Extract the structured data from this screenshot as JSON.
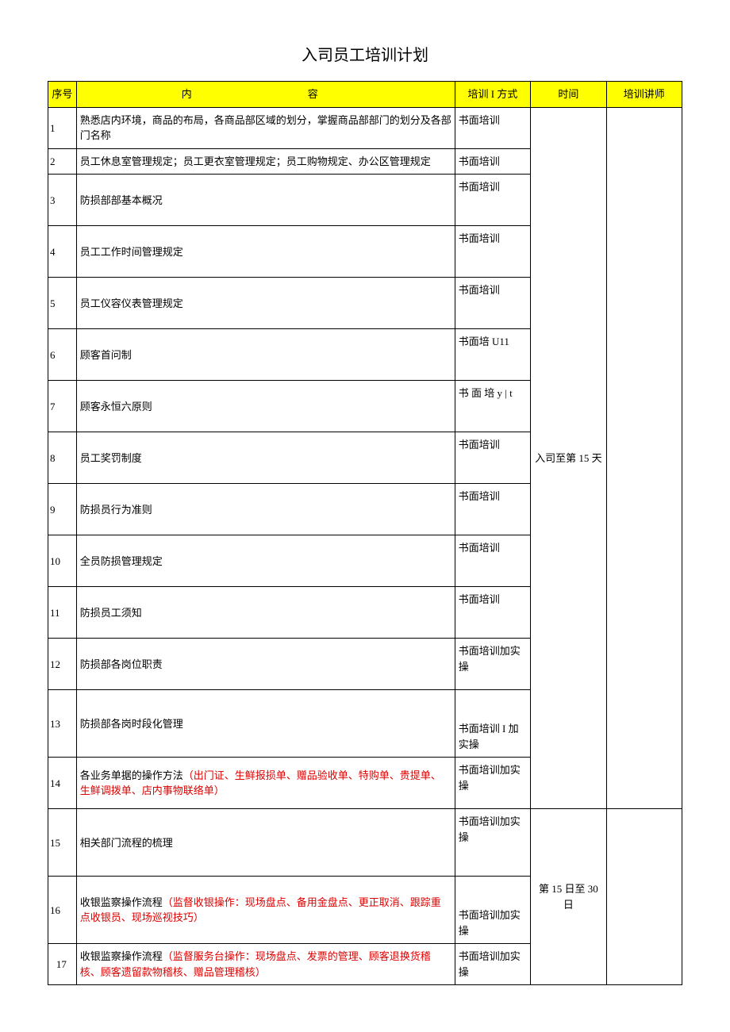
{
  "title": "入司员工培训计划",
  "headers": {
    "num": "序号",
    "content": "内　　容",
    "method": "培训 I 方式",
    "time": "时间",
    "instructor": "培训讲师"
  },
  "time_block_1": "入司至第 15 天",
  "time_block_2": "第 15 日至 30 日",
  "rows": [
    {
      "n": "1",
      "content": "熟悉店内环境，商品的布局，各商品部区域的划分，掌握商品部部门的划分及各部门名称",
      "method": "书面培训"
    },
    {
      "n": "2",
      "content": "员工休息室管理规定；员工更衣室管理规定；员工购物规定、办公区管理规定",
      "method": "书面培训"
    },
    {
      "n": "3",
      "content": "防损部部基本概况",
      "method": "书面培训"
    },
    {
      "n": "4",
      "content": "员工工作时间管理规定",
      "method": "书面培训"
    },
    {
      "n": "5",
      "content": "员工仪容仪表管理规定",
      "method": "书面培训"
    },
    {
      "n": "6",
      "content": "顾客首问制",
      "method": "书面培 U11"
    },
    {
      "n": "7",
      "content": "顾客永恒六原则",
      "method": "书 面 培 y | t"
    },
    {
      "n": "8",
      "content": "员工奖罚制度",
      "method": "书面培训"
    },
    {
      "n": "9",
      "content": "防损员行为准则",
      "method": "书面培训"
    },
    {
      "n": "10",
      "content": "全员防损管理规定",
      "method": "书面培训"
    },
    {
      "n": "11",
      "content": "防损员工须知",
      "method": "书面培训"
    },
    {
      "n": "12",
      "content": "防损部各岗位职责",
      "method": "书面培训加实操"
    },
    {
      "n": "13",
      "content": "防损部各岗时段化管理",
      "method": "书面培训 I 加实操"
    },
    {
      "n": "14",
      "content_main": "各业务单据的操作方法",
      "content_red": "（出门证、生鲜报损单、赠品验收单、特购单、贵提单、生鲜调拨单、店内事物联络单）",
      "method": "书面培训加实操"
    },
    {
      "n": "15",
      "content": "相关部门流程的梳理",
      "method": "书面培训加实操"
    },
    {
      "n": "16",
      "content_main": "收银监察操作流程",
      "content_red": "（监督收银操作：现场盘点、备用金盘点、更正取消、跟踪重点收银员、现场巡视技巧）",
      "method": "书面培训加实操"
    },
    {
      "n": "17",
      "content_main": "收银监察操作流程",
      "content_red": "（监督服务台操作：现场盘点、发票的管理、顾客退换货稽核、顾客遗留款物稽核、赠品管理稽核）",
      "method": "书面培训加实操"
    }
  ]
}
